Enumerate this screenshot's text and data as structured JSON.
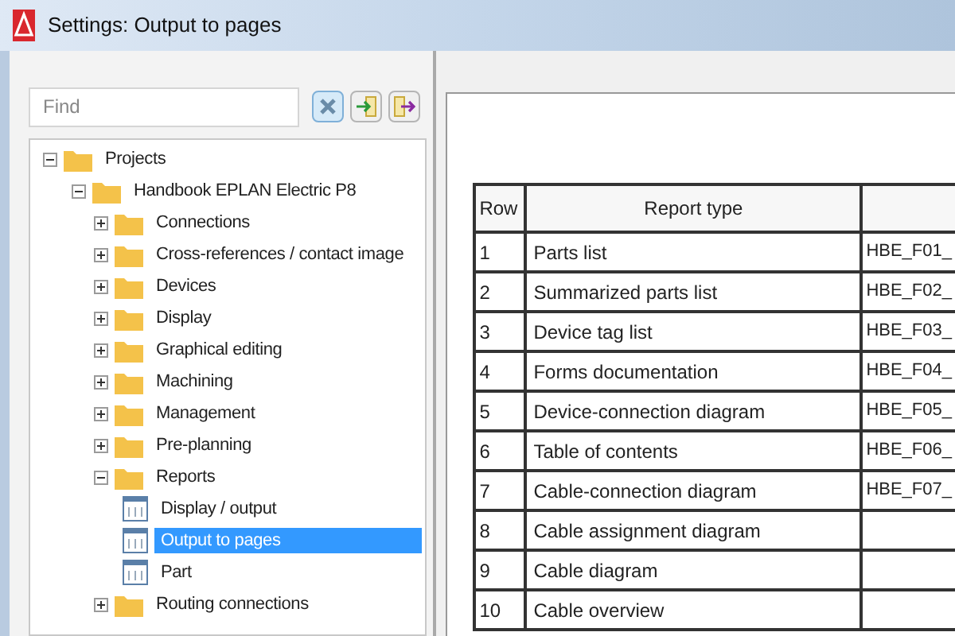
{
  "window": {
    "title": "Settings: Output to pages"
  },
  "search": {
    "placeholder": "Find"
  },
  "toolbar": [
    {
      "kind": "clear"
    },
    {
      "kind": "import"
    },
    {
      "kind": "export"
    }
  ],
  "tree": [
    {
      "label": "Projects",
      "kind": "folder",
      "expanded": true,
      "selected": false,
      "children": [
        {
          "label": "Handbook EPLAN Electric P8",
          "kind": "folder",
          "expanded": true,
          "selected": false,
          "children": [
            {
              "label": "Connections",
              "kind": "folder",
              "expanded": false,
              "selected": false
            },
            {
              "label": "Cross-references / contact image",
              "kind": "folder",
              "expanded": false,
              "selected": false
            },
            {
              "label": "Devices",
              "kind": "folder",
              "expanded": false,
              "selected": false
            },
            {
              "label": "Display",
              "kind": "folder",
              "expanded": false,
              "selected": false
            },
            {
              "label": "Graphical editing",
              "kind": "folder",
              "expanded": false,
              "selected": false
            },
            {
              "label": "Machining",
              "kind": "folder",
              "expanded": false,
              "selected": false
            },
            {
              "label": "Management",
              "kind": "folder",
              "expanded": false,
              "selected": false
            },
            {
              "label": "Pre-planning",
              "kind": "folder",
              "expanded": false,
              "selected": false
            },
            {
              "label": "Reports",
              "kind": "folder",
              "expanded": true,
              "selected": false,
              "children": [
                {
                  "label": "Display / output",
                  "kind": "page",
                  "selected": false
                },
                {
                  "label": "Output to pages",
                  "kind": "page",
                  "selected": true
                },
                {
                  "label": "Part",
                  "kind": "page",
                  "selected": false
                }
              ]
            },
            {
              "label": "Routing connections",
              "kind": "folder",
              "expanded": false,
              "selected": false
            }
          ]
        }
      ]
    }
  ],
  "table": {
    "columns": [
      "Row",
      "Report type"
    ],
    "rows": [
      {
        "row": "1",
        "type": "Parts list",
        "column_3": "HBE_F01_"
      },
      {
        "row": "2",
        "type": "Summarized parts list",
        "column_3": "HBE_F02_"
      },
      {
        "row": "3",
        "type": "Device tag list",
        "column_3": "HBE_F03_"
      },
      {
        "row": "4",
        "type": "Forms documentation",
        "column_3": "HBE_F04_"
      },
      {
        "row": "5",
        "type": "Device-connection diagram",
        "column_3": "HBE_F05_"
      },
      {
        "row": "6",
        "type": "Table of contents",
        "column_3": "HBE_F06_"
      },
      {
        "row": "7",
        "type": "Cable-connection diagram",
        "column_3": "HBE_F07_"
      },
      {
        "row": "8",
        "type": "Cable assignment diagram"
      },
      {
        "row": "9",
        "type": "Cable diagram"
      },
      {
        "row": "10",
        "type": "Cable overview"
      }
    ]
  }
}
